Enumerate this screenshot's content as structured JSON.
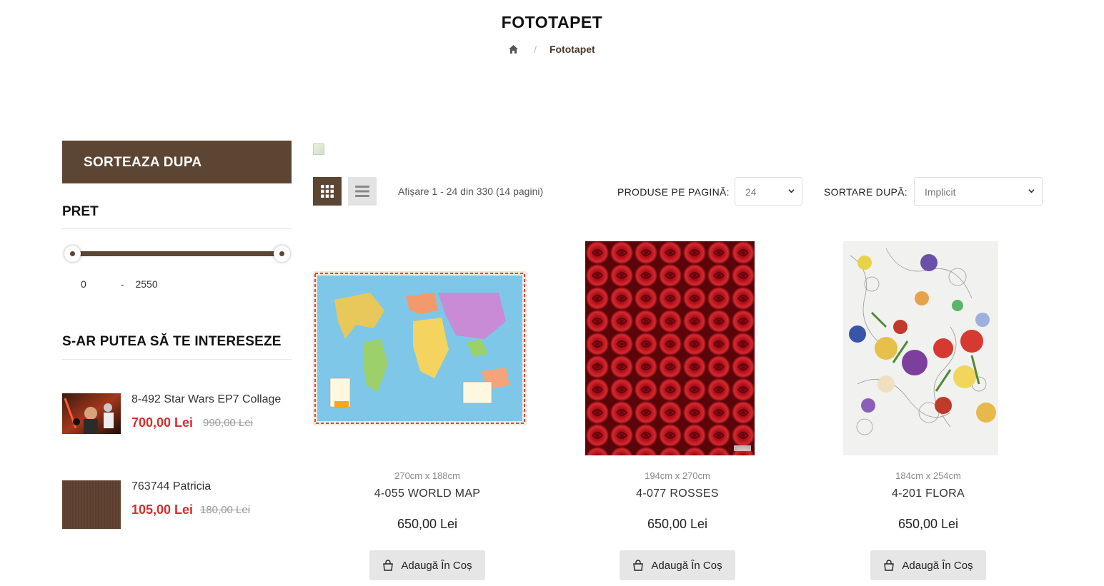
{
  "header": {
    "title": "FOTOTAPET",
    "breadcrumb": {
      "home_icon": "home-icon",
      "current": "Fototapet"
    }
  },
  "sidebar": {
    "sort_header": "SORTEAZA DUPA",
    "price": {
      "title": "PRET",
      "min": "0",
      "separator": "-",
      "max": "2550"
    },
    "interest": {
      "title": "S-AR PUTEA SĂ TE INTERESEZE",
      "items": [
        {
          "name": "8-492 Star Wars EP7 Collage",
          "price": "700,00 Lei",
          "old_price": "990,00 Lei"
        },
        {
          "name": "763744 Patricia",
          "price": "105,00 Lei",
          "old_price": "180,00 Lei"
        }
      ]
    }
  },
  "toolbar": {
    "showing": "Afișare 1 - 24 din 330 (14 pagini)",
    "per_page_label": "PRODUSE PE PAGINĂ:",
    "per_page_value": "24",
    "sort_label": "SORTARE DUPĂ:",
    "sort_value": "Implicit"
  },
  "products": [
    {
      "dims": "270cm x 188cm",
      "name": "4-055 WORLD MAP",
      "price": "650,00 Lei",
      "button": "Adaugă În Coș"
    },
    {
      "dims": "194cm x 270cm",
      "name": "4-077 ROSSES",
      "price": "650,00 Lei",
      "button": "Adaugă În Coș"
    },
    {
      "dims": "184cm x 254cm",
      "name": "4-201 FLORA",
      "price": "650,00 Lei",
      "button": "Adaugă În Coș"
    }
  ],
  "colors": {
    "brand": "#5c4533",
    "sale": "#d32f2f",
    "button_bg": "#e6e6e6"
  }
}
